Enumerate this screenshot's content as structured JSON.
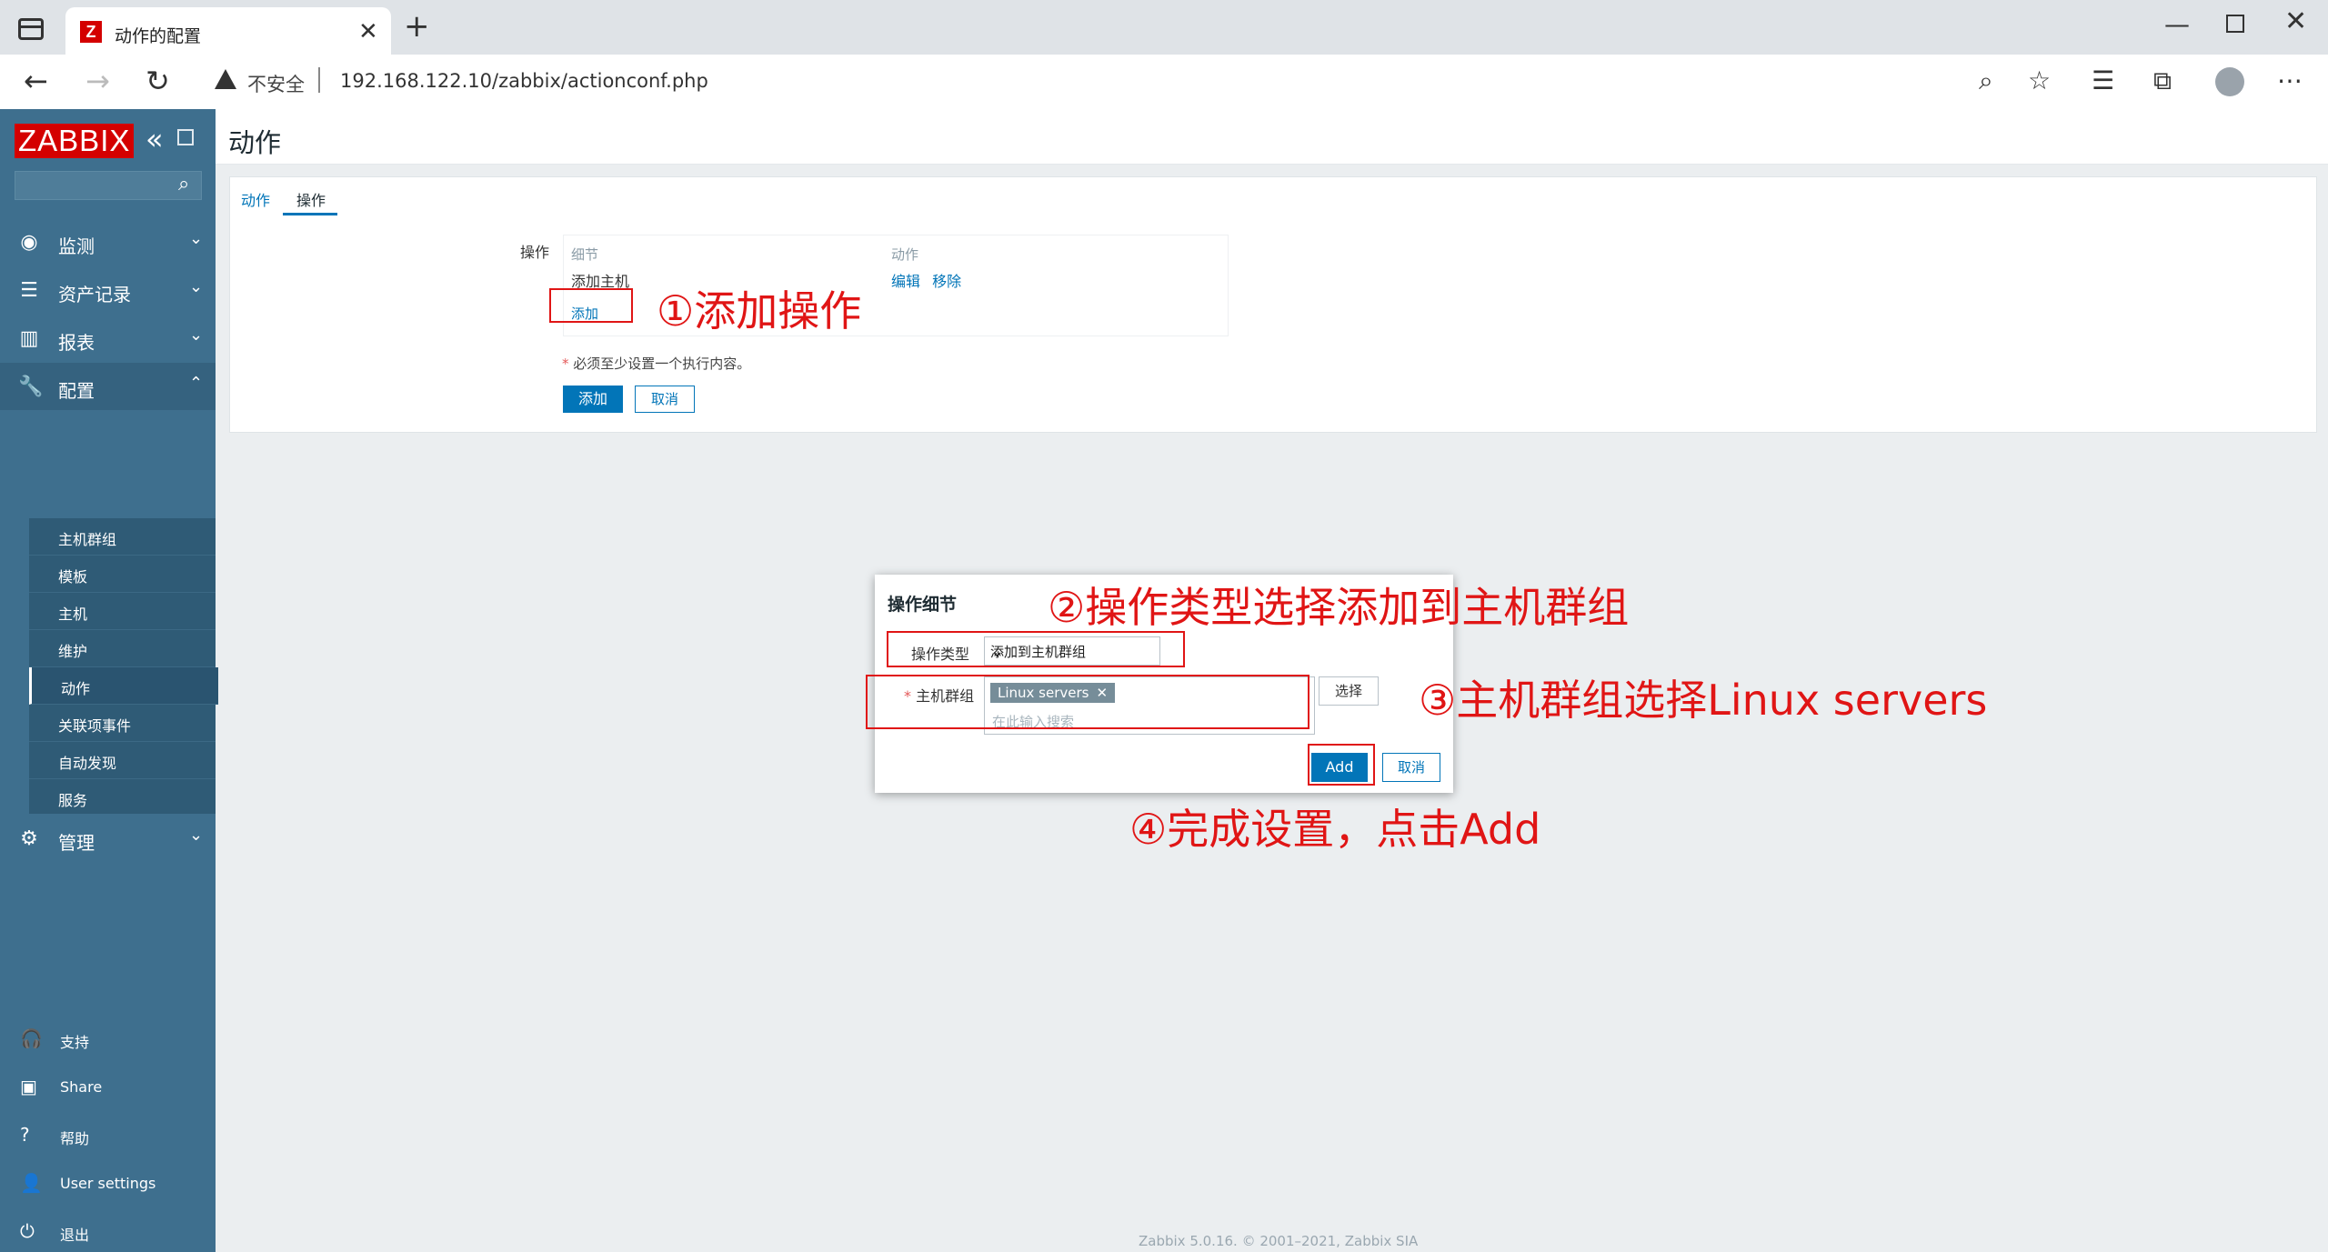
{
  "browser": {
    "tab_title": "动作的配置",
    "tab_favicon": "Z",
    "security_label": "不安全",
    "url": "192.168.122.10/zabbix/actionconf.php"
  },
  "sidebar": {
    "logo": "ZABBIX",
    "menu": [
      {
        "label": "监测",
        "icon": "eye-icon"
      },
      {
        "label": "资产记录",
        "icon": "list-icon"
      },
      {
        "label": "报表",
        "icon": "bar-chart-icon"
      },
      {
        "label": "配置",
        "icon": "wrench-icon"
      },
      {
        "label": "管理",
        "icon": "gear-icon"
      }
    ],
    "submenu": [
      "主机群组",
      "模板",
      "主机",
      "维护",
      "动作",
      "关联项事件",
      "自动发现",
      "服务"
    ],
    "footer": [
      {
        "label": "支持",
        "icon": "headset-icon"
      },
      {
        "label": "Share",
        "icon": "share-icon"
      },
      {
        "label": "帮助",
        "icon": "help-icon"
      },
      {
        "label": "User settings",
        "icon": "user-icon"
      },
      {
        "label": "退出",
        "icon": "power-icon"
      }
    ]
  },
  "page": {
    "title": "动作",
    "tabs": [
      "动作",
      "操作"
    ],
    "operations_label": "操作",
    "col_detail": "细节",
    "col_action": "动作",
    "op_detail": "添加主机",
    "op_edit": "编辑",
    "op_remove": "移除",
    "op_add_link": "添加",
    "required_note": "必须至少设置一个执行内容。",
    "btn_add": "添加",
    "btn_cancel": "取消"
  },
  "modal": {
    "title": "操作细节",
    "type_label": "操作类型",
    "type_value": "添加到主机群组",
    "group_label": "主机群组",
    "chip": "Linux servers",
    "placeholder": "在此输入搜索",
    "btn_select": "选择",
    "btn_add": "Add",
    "btn_cancel": "取消"
  },
  "annotations": {
    "a1": "①添加操作",
    "a2": "②操作类型选择添加到主机群组",
    "a3": "③主机群组选择Linux servers",
    "a4": "④完成设置，点击Add"
  },
  "footer": "Zabbix 5.0.16. © 2001–2021, Zabbix SIA",
  "colors": {
    "accent": "#0275b8",
    "sidebar": "#3e6f8e",
    "logo": "#d40000",
    "annotation": "#e01515"
  }
}
